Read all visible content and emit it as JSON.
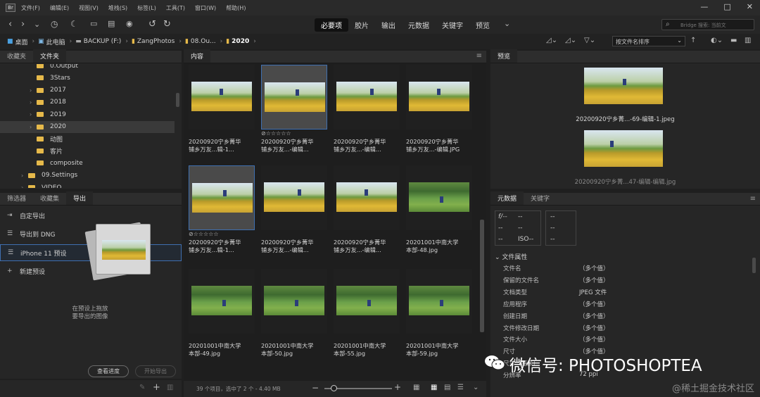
{
  "menu": [
    "文件(F)",
    "编辑(E)",
    "视图(V)",
    "堆栈(S)",
    "标签(L)",
    "工具(T)",
    "窗口(W)",
    "帮助(H)"
  ],
  "window_controls": [
    "—",
    "□",
    "✕"
  ],
  "workspaces": [
    "必要项",
    "胶片",
    "输出",
    "元数据",
    "关键字",
    "预览"
  ],
  "active_workspace": "必要项",
  "search_placeholder": "Bridge 搜索: 当前文",
  "breadcrumb": [
    "桌面",
    "此电脑",
    "BACKUP (F:)",
    "ZangPhotos",
    "08.Ou...",
    "2020"
  ],
  "sort_select": "按文件名排序",
  "left_tabs": [
    "收藏夹",
    "文件夹"
  ],
  "left_active_tab": "文件夹",
  "folders": [
    {
      "name": "0.Output",
      "indent": 2
    },
    {
      "name": "3Stars",
      "indent": 2
    },
    {
      "name": "2017",
      "indent": 2
    },
    {
      "name": "2018",
      "indent": 2
    },
    {
      "name": "2019",
      "indent": 2
    },
    {
      "name": "2020",
      "indent": 2
    },
    {
      "name": "动图",
      "indent": 2
    },
    {
      "name": "客片",
      "indent": 2
    },
    {
      "name": "composite",
      "indent": 2
    },
    {
      "name": "09.Settings",
      "indent": 1
    },
    {
      "name": "VIDEO",
      "indent": 1
    }
  ],
  "selected_folder": "2020",
  "bottom_tabs": [
    "筛选器",
    "收藏集",
    "导出"
  ],
  "bottom_active_tab": "导出",
  "export_items": [
    "自定导出",
    "导出到 DNG",
    "iPhone 11 预设",
    "新建预设"
  ],
  "export_hint": [
    "在预设上拖放",
    "要导出的图像"
  ],
  "export_buttons": [
    "查看进度",
    "开始导出"
  ],
  "content_tab": "内容",
  "thumbnails": [
    {
      "caption": [
        "20200920宁乡菁华",
        "铺乡万友...辑-1..."
      ],
      "type": "field",
      "selected": false,
      "rating": false
    },
    {
      "caption": [
        "20200920宁乡菁华",
        "铺乡万友...-编辑..."
      ],
      "type": "field",
      "selected": true,
      "rating": true
    },
    {
      "caption": [
        "20200920宁乡菁华",
        "铺乡万友...-编辑..."
      ],
      "type": "field",
      "selected": false,
      "rating": false
    },
    {
      "caption": [
        "20200920宁乡菁华",
        "铺乡万友...-编辑.JPG"
      ],
      "type": "field",
      "selected": false,
      "rating": false
    },
    {
      "caption": [
        "20200920宁乡菁华",
        "铺乡万友...辑-1..."
      ],
      "type": "field",
      "selected": true,
      "rating": true
    },
    {
      "caption": [
        "20200920宁乡菁华",
        "铺乡万友...-编辑..."
      ],
      "type": "field",
      "selected": false,
      "rating": false
    },
    {
      "caption": [
        "20200920宁乡菁华",
        "铺乡万友...-编辑..."
      ],
      "type": "field",
      "selected": false,
      "rating": false
    },
    {
      "caption": [
        "20201001中南大学",
        "本部-48.jpg"
      ],
      "type": "park",
      "selected": false,
      "rating": false
    },
    {
      "caption": [
        "20201001中南大学",
        "本部-49.jpg"
      ],
      "type": "park",
      "selected": false,
      "rating": false
    },
    {
      "caption": [
        "20201001中南大学",
        "本部-50.jpg"
      ],
      "type": "park",
      "selected": false,
      "rating": false
    },
    {
      "caption": [
        "20201001中南大学",
        "本部-55.jpg"
      ],
      "type": "park",
      "selected": false,
      "rating": false
    },
    {
      "caption": [
        "20201001中南大学",
        "本部-59.jpg"
      ],
      "type": "park",
      "selected": false,
      "rating": false
    }
  ],
  "status": "39 个项目，选中了 2 个 - 4.40 MB",
  "preview_tab": "预览",
  "preview_captions": [
    "20200920宁乡菁...-69-编辑-1.jpeg",
    "20200920宁乡菁...47-编辑-编辑.jpg"
  ],
  "meta_tabs": [
    "元数据",
    "关键字"
  ],
  "meta_active_tab": "元数据",
  "camera_info": {
    "aperture": "f/--",
    "a2": "--",
    "a3": "--",
    "iso": "ISO--",
    "b1": "--",
    "b2": "--",
    "b3": "--"
  },
  "file_props_title": "文件属性",
  "file_props": [
    {
      "label": "文件名",
      "value": "（多个值）"
    },
    {
      "label": "保留的文件名",
      "value": "（多个值）"
    },
    {
      "label": "文档类型",
      "value": "JPEG 文件"
    },
    {
      "label": "应用程序",
      "value": "（多个值）"
    },
    {
      "label": "创建日期",
      "value": "（多个值）"
    },
    {
      "label": "文件修改日期",
      "value": "（多个值）"
    },
    {
      "label": "文件大小",
      "value": "（多个值）"
    },
    {
      "label": "尺寸",
      "value": "（多个值）"
    },
    {
      "label": "尺寸（厘米）",
      "value": ""
    },
    {
      "label": "分辨率",
      "value": "72 ppi"
    }
  ],
  "watermark": "微信号: PHOTOSHOPTEA",
  "corner_watermark": "@稀土掘金技术社区",
  "icons": [
    "bridge-logo",
    "back-icon",
    "forward-icon",
    "recent-icon",
    "boomerang-icon",
    "camera-icon",
    "rotate-ccw-icon",
    "rotate-cw-icon",
    "star-filter-icon",
    "sort-asc-icon",
    "folder-icon"
  ],
  "accent_color": "#3f6fb0"
}
